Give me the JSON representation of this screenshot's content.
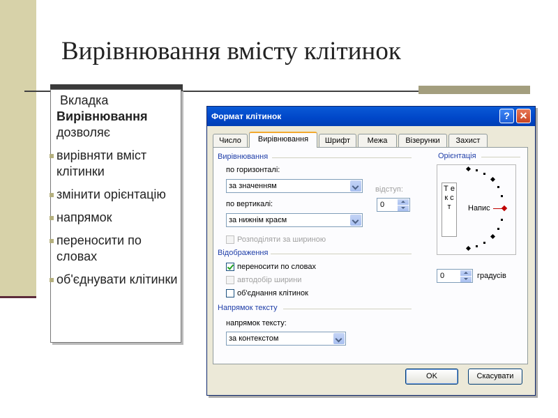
{
  "slide": {
    "title": "Вирівнювання вмісту клітинок",
    "intro_prefix": "Вкладка",
    "intro_bold": "Вирівнювання",
    "intro_suffix": "дозволяє",
    "bullets": [
      "вирівняти вміст клітинки",
      "змінити орієнтацію",
      "напрямок",
      "переносити по словах",
      "об'єднувати клітинки"
    ]
  },
  "dialog": {
    "title": "Формат клітинок",
    "help_glyph": "?",
    "close_glyph": "✕",
    "tabs": [
      "Число",
      "Вирівнювання",
      "Шрифт",
      "Межа",
      "Візерунки",
      "Захист"
    ],
    "active_tab": "Вирівнювання",
    "alignment": {
      "section": "Вирівнювання",
      "horizontal_label": "по горизонталі:",
      "horizontal_value": "за значенням",
      "vertical_label": "по вертикалі:",
      "vertical_value": "за нижнім краєм",
      "indent_label": "відступ:",
      "indent_value": "0",
      "distribute_label": "Розподіляти за шириною"
    },
    "display": {
      "section": "Відображення",
      "wrap_label": "переносити по словах",
      "wrap_checked": true,
      "autofit_label": "автодобір ширини",
      "autofit_checked": false,
      "merge_label": "об'єднання клітинок",
      "merge_checked": false
    },
    "direction": {
      "section": "Напрямок тексту",
      "label": "напрямок тексту:",
      "value": "за контекстом"
    },
    "orientation": {
      "section": "Орієнтація",
      "vertical_text": "Т е к с т",
      "dial_label": "Напис",
      "degrees_value": "0",
      "degrees_label": "градусів"
    },
    "ok_label": "OK",
    "cancel_label": "Скасувати"
  }
}
